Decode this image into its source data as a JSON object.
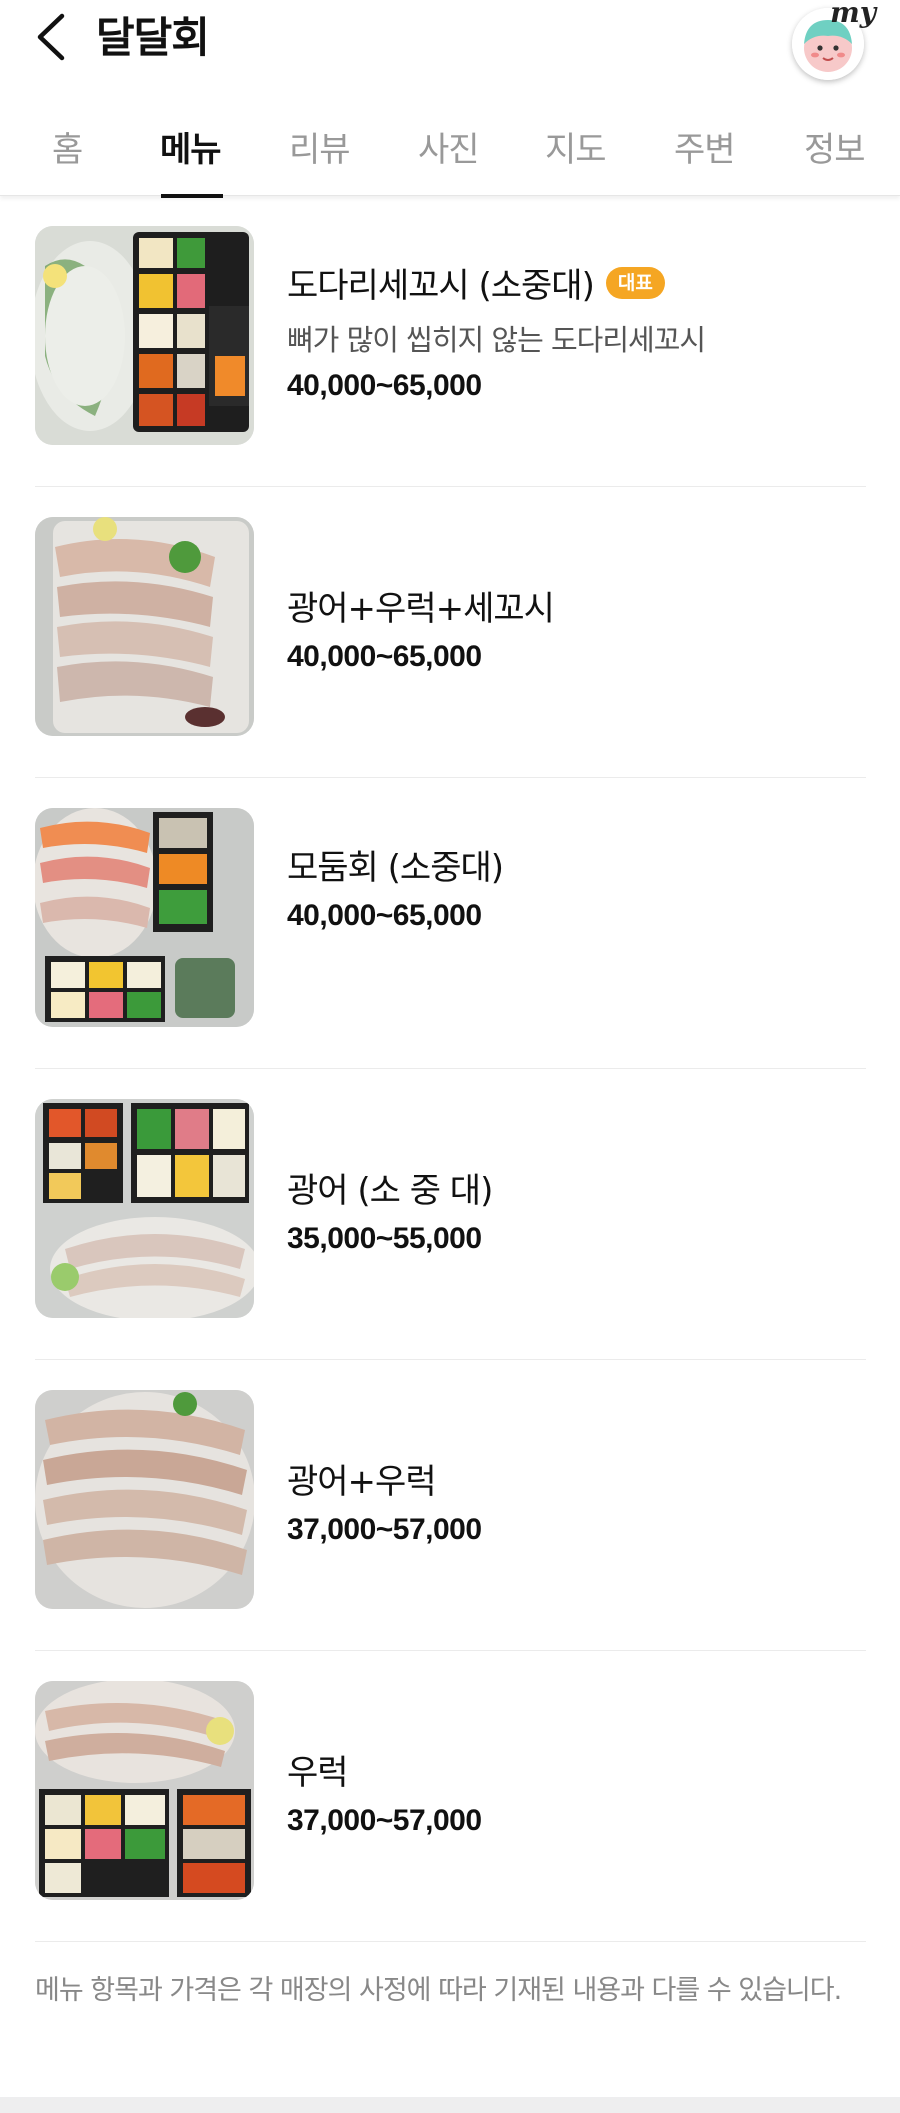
{
  "header": {
    "title": "달달회",
    "my_label": "my"
  },
  "tabs": [
    {
      "label": "홈"
    },
    {
      "label": "메뉴"
    },
    {
      "label": "리뷰"
    },
    {
      "label": "사진"
    },
    {
      "label": "지도"
    },
    {
      "label": "주변"
    },
    {
      "label": "정보"
    }
  ],
  "active_tab": "메뉴",
  "menu": [
    {
      "name": "도다리세꼬시 (소중대)",
      "badge": "대표",
      "description": "뼈가 많이 씹히지 않는 도다리세꼬시",
      "price": "40,000~65,000"
    },
    {
      "name": "광어+우럭+세꼬시",
      "price": "40,000~65,000"
    },
    {
      "name": "모둠회 (소중대)",
      "price": "40,000~65,000"
    },
    {
      "name": "광어 (소 중 대)",
      "price": "35,000~55,000"
    },
    {
      "name": "광어+우럭",
      "price": "37,000~57,000"
    },
    {
      "name": "우럭",
      "price": "37,000~57,000"
    }
  ],
  "notice": "메뉴 항목과 가격은 각 매장의 사정에 따라 기재된 내용과 다를 수 있습니다.",
  "colors": {
    "badge": "#f5a623",
    "active_tab": "#111111",
    "inactive_tab": "#999999"
  }
}
